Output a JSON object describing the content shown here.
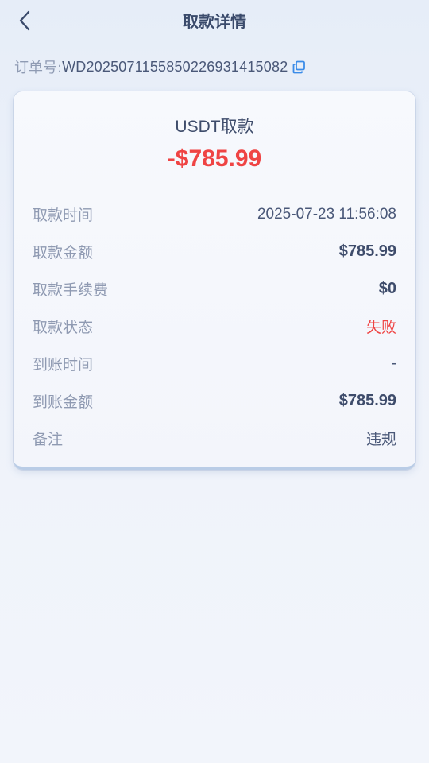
{
  "header": {
    "title": "取款详情",
    "back_icon": "chevron-left-icon"
  },
  "order": {
    "label": "订单号:",
    "value": "WD2025071155850226931415082",
    "copy_icon": "copy-icon"
  },
  "card": {
    "type": "USDT取款",
    "amount": "-$785.99",
    "details": [
      {
        "label": "取款时间",
        "value": "2025-07-23 11:56:08"
      },
      {
        "label": "取款金额",
        "value": "$785.99"
      },
      {
        "label": "取款手续费",
        "value": "$0"
      },
      {
        "label": "取款状态",
        "value": "失败"
      },
      {
        "label": "到账时间",
        "value": "-"
      },
      {
        "label": "到账金额",
        "value": "$785.99"
      },
      {
        "label": "备注",
        "value": "违规"
      }
    ]
  },
  "colors": {
    "accent_red": "#ef4444",
    "text_dark": "#3e4c6b",
    "text_muted": "#8f9ab2",
    "copy_blue": "#3b8ce8"
  }
}
